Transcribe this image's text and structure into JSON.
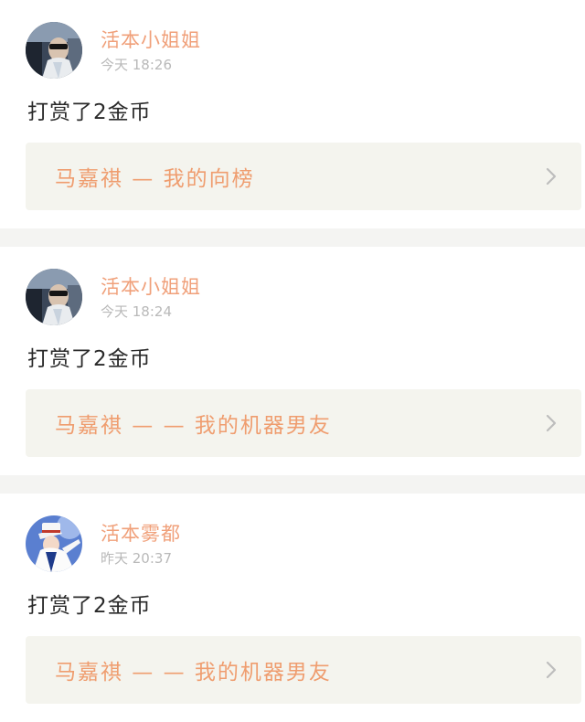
{
  "feed": {
    "items": [
      {
        "user": "活本小姐姐",
        "time": "今天 18:26",
        "action": "打赏了2金币",
        "work": "马嘉祺 — 我的向榜",
        "avatar": "avatar-photo-driver"
      },
      {
        "user": "活本小姐姐",
        "time": "今天 18:24",
        "action": "打赏了2金币",
        "work": "马嘉祺 — — 我的机器男友",
        "avatar": "avatar-photo-driver"
      },
      {
        "user": "活本雾都",
        "time": "昨天 20:37",
        "action": "打赏了2金币",
        "work": "马嘉祺 — — 我的机器男友",
        "avatar": "avatar-anime-character"
      }
    ]
  },
  "colors": {
    "name": "#f0a07a",
    "time": "#b9b9b9",
    "link_bg": "#f4f4ee",
    "link_text": "#ef9d6f",
    "chevron": "#bdbdbd",
    "divider": "#f4f4f2"
  },
  "icons": {
    "chevron": "chevron-right-icon"
  }
}
